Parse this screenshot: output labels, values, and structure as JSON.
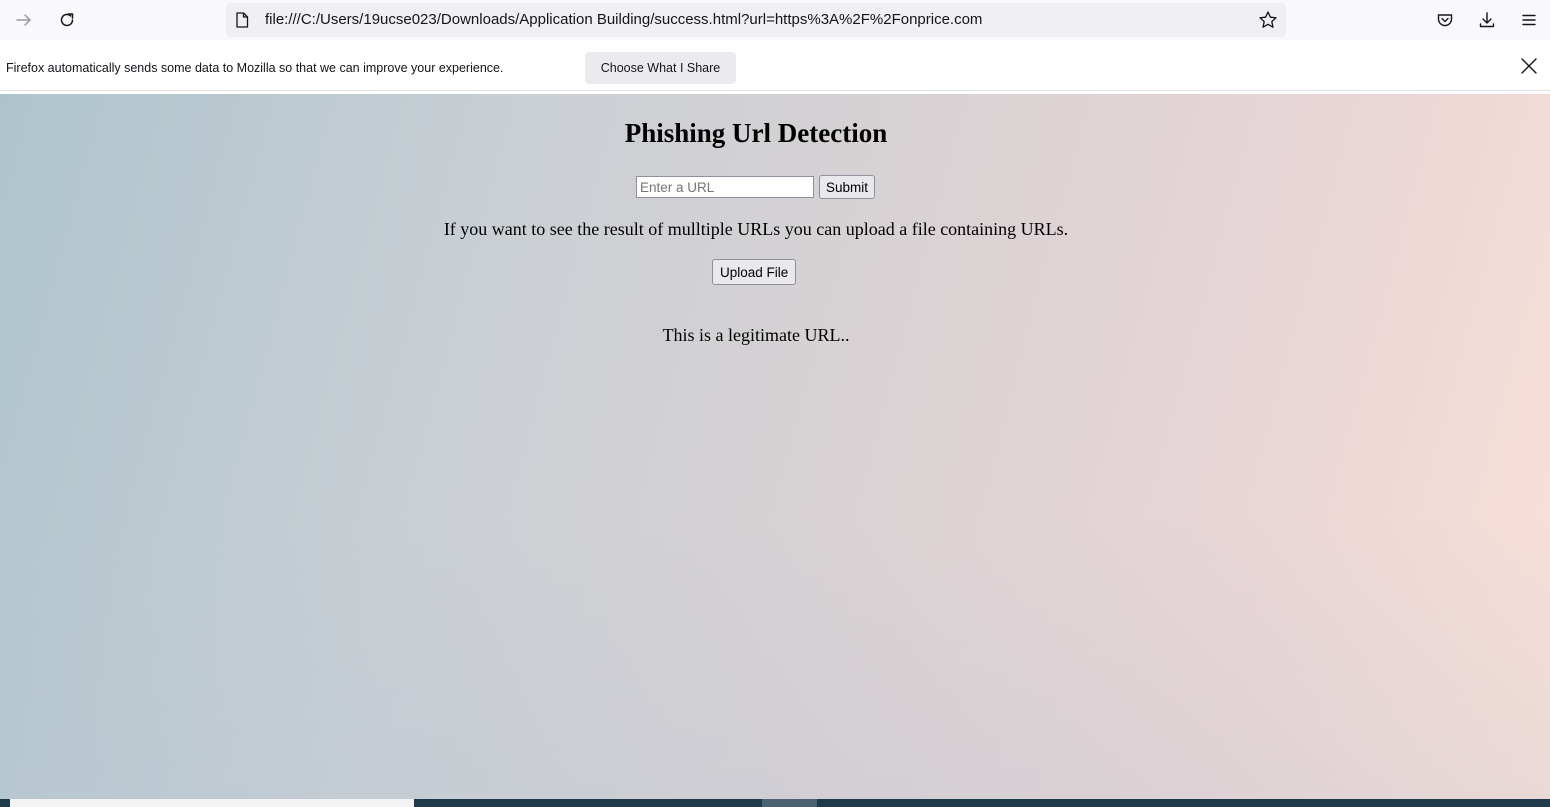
{
  "browser": {
    "url": "file:///C:/Users/19ucse023/Downloads/Application Building/success.html?url=https%3A%2F%2Fonprice.com",
    "icons": {
      "forward": "arrow-right-icon",
      "reload": "reload-icon",
      "page": "page-icon",
      "bookmark": "star-icon",
      "pocket": "pocket-icon",
      "downloads": "download-icon",
      "menu": "hamburger-menu-icon",
      "close": "close-icon"
    }
  },
  "notification": {
    "message": "Firefox automatically sends some data to Mozilla so that we can improve your experience.",
    "button_label": "Choose What I Share"
  },
  "page": {
    "title": "Phishing Url Detection",
    "url_input": {
      "value": "",
      "placeholder": "Enter a URL"
    },
    "submit_label": "Submit",
    "info_text": "If you want to see the result of mulltiple URLs you can upload a file containing URLs.",
    "upload_label": "Upload File",
    "result_text": "This is a legitimate URL.."
  },
  "colors": {
    "background_gradient_start": "#aec4cd",
    "background_gradient_end": "#fbe0d8",
    "toolbar": "#f9f9fb",
    "urlbar": "#f0f0f4"
  }
}
